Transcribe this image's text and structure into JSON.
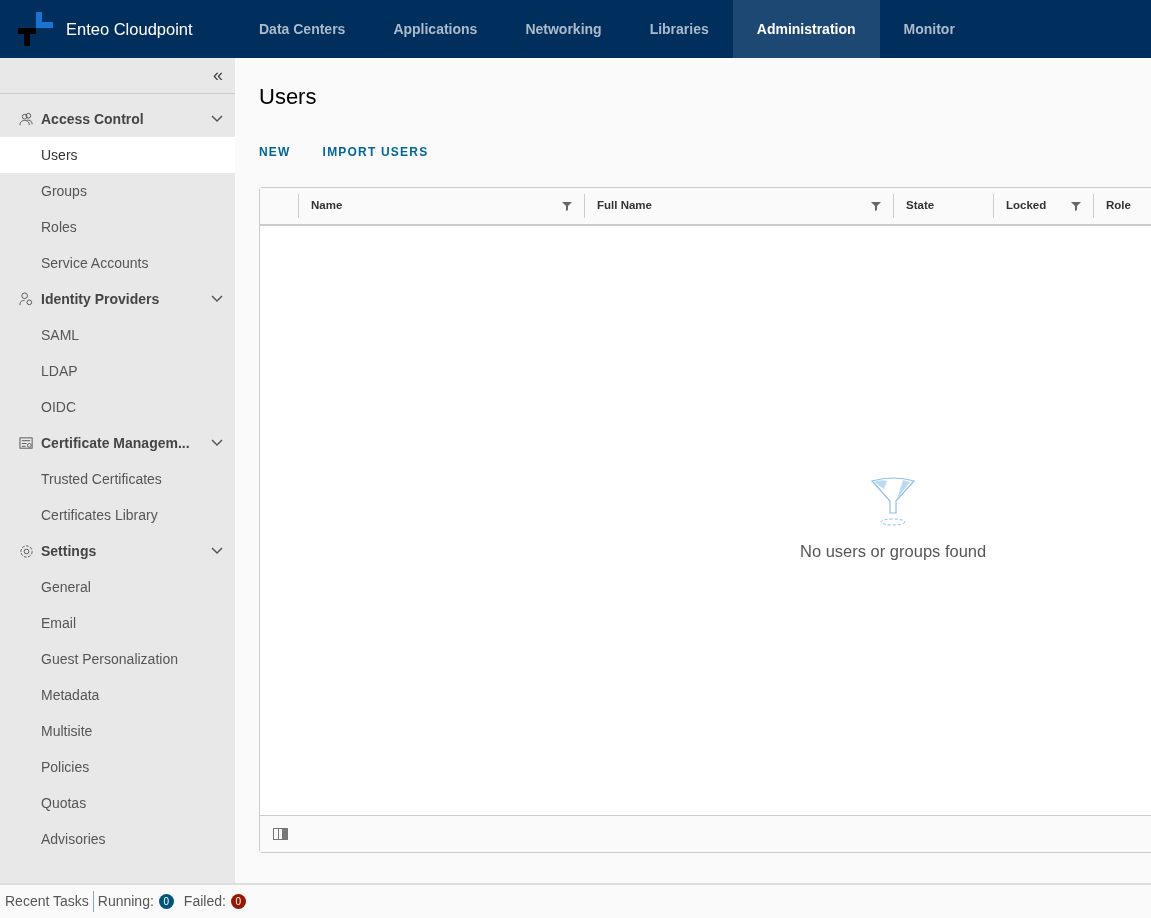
{
  "app": {
    "title": "Enteo Cloudpoint"
  },
  "nav_tabs": [
    {
      "label": "Data Centers",
      "selected": false
    },
    {
      "label": "Applications",
      "selected": false
    },
    {
      "label": "Networking",
      "selected": false
    },
    {
      "label": "Libraries",
      "selected": false
    },
    {
      "label": "Administration",
      "selected": true
    },
    {
      "label": "Monitor",
      "selected": false
    }
  ],
  "sidebar": {
    "collapse_toggle": "«",
    "groups": [
      {
        "label": "Access Control",
        "expanded": true,
        "items": [
          {
            "label": "Users",
            "selected": true
          },
          {
            "label": "Groups",
            "selected": false
          },
          {
            "label": "Roles",
            "selected": false
          },
          {
            "label": "Service Accounts",
            "selected": false
          }
        ]
      },
      {
        "label": "Identity Providers",
        "expanded": true,
        "items": [
          {
            "label": "SAML",
            "selected": false
          },
          {
            "label": "LDAP",
            "selected": false
          },
          {
            "label": "OIDC",
            "selected": false
          }
        ]
      },
      {
        "label": "Certificate Managem...",
        "expanded": true,
        "items": [
          {
            "label": "Trusted Certificates",
            "selected": false
          },
          {
            "label": "Certificates Library",
            "selected": false
          }
        ]
      },
      {
        "label": "Settings",
        "expanded": true,
        "items": [
          {
            "label": "General",
            "selected": false
          },
          {
            "label": "Email",
            "selected": false
          },
          {
            "label": "Guest Personalization",
            "selected": false
          },
          {
            "label": "Metadata",
            "selected": false
          },
          {
            "label": "Multisite",
            "selected": false
          },
          {
            "label": "Policies",
            "selected": false
          },
          {
            "label": "Quotas",
            "selected": false
          },
          {
            "label": "Advisories",
            "selected": false
          }
        ]
      }
    ]
  },
  "page": {
    "title": "Users",
    "actions": [
      "NEW",
      "IMPORT USERS"
    ]
  },
  "table": {
    "columns": [
      {
        "label": "Name",
        "filterable": true
      },
      {
        "label": "Full Name",
        "filterable": true
      },
      {
        "label": "State",
        "filterable": false
      },
      {
        "label": "Locked",
        "filterable": true
      },
      {
        "label": "Role"
      }
    ],
    "empty_message": "No users or groups found"
  },
  "status_bar": {
    "label": "Recent Tasks",
    "counters": [
      {
        "label": "Running:",
        "count": "0",
        "color": "#00567a"
      },
      {
        "label": "Failed:",
        "count": "0",
        "color": "#991700"
      }
    ]
  }
}
